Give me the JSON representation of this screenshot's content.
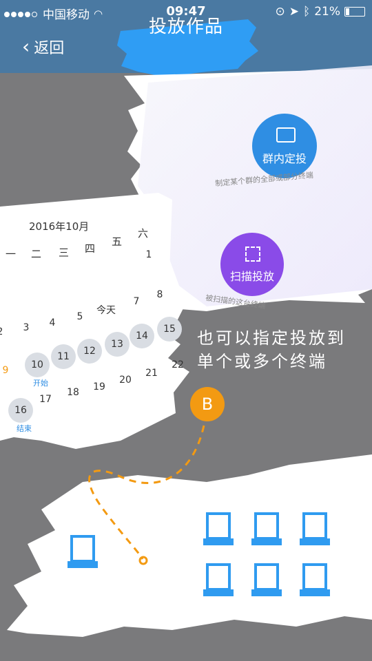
{
  "status_bar": {
    "carrier": "中国移动",
    "time": "09:47",
    "battery": "21%"
  },
  "nav": {
    "back_label": "返回",
    "title": "投放作品"
  },
  "calendar": {
    "month_title": "2016年10月",
    "weekdays": [
      "一",
      "二",
      "三",
      "四",
      "五",
      "六"
    ],
    "days": [
      "1",
      "2",
      "3",
      "4",
      "5",
      "今天",
      "7",
      "8",
      "9",
      "10",
      "11",
      "12",
      "13",
      "14",
      "15",
      "16",
      "17",
      "18",
      "19",
      "20",
      "21",
      "22"
    ],
    "start_tag": "开始",
    "end_tag": "结束"
  },
  "options": {
    "group_label": "群内定投",
    "group_caption": "制定某个群的全部或部分终端",
    "scan_label": "扫描投放",
    "scan_caption": "被扫描的这台终端"
  },
  "callout": {
    "line1": "也可以指定投放到",
    "line2": "单个或多个终端",
    "badge": "B"
  },
  "colors": {
    "nav_bg": "#4a79a2",
    "accent_blue": "#2f8ee3",
    "purple": "#8a4be8",
    "orange": "#f39a12",
    "terminal_blue": "#2f9bf0"
  }
}
